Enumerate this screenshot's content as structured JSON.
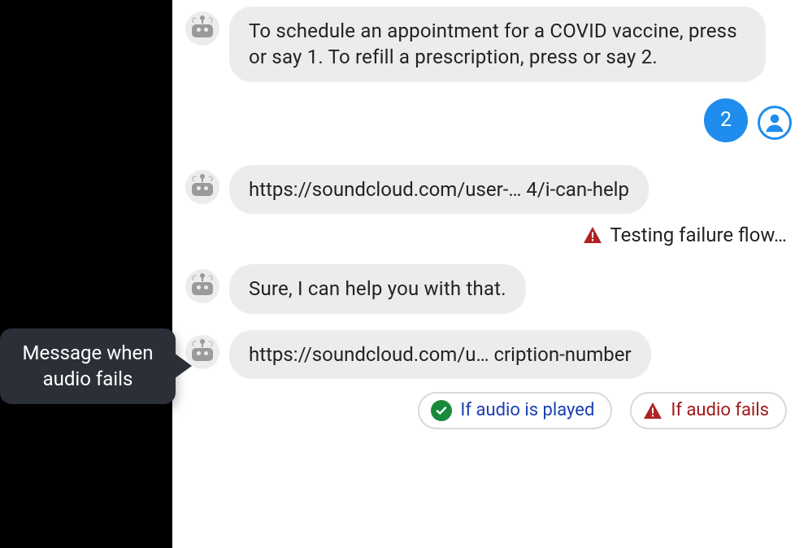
{
  "messages": {
    "bot1": "To schedule an appointment for a COVID vaccine, press or say 1. To refill a prescription, press or say 2.",
    "user1": "2",
    "bot2": "https://soundcloud.com/user-… 4/i-can-help",
    "status1": "Testing failure flow…",
    "bot3": "Sure, I can help you with that.",
    "bot4": "https://soundcloud.com/u… cription-number"
  },
  "callout": {
    "line1": "Message when",
    "line2": "audio fails"
  },
  "chips": {
    "ok": "If audio is played",
    "fail": "If audio fails"
  }
}
